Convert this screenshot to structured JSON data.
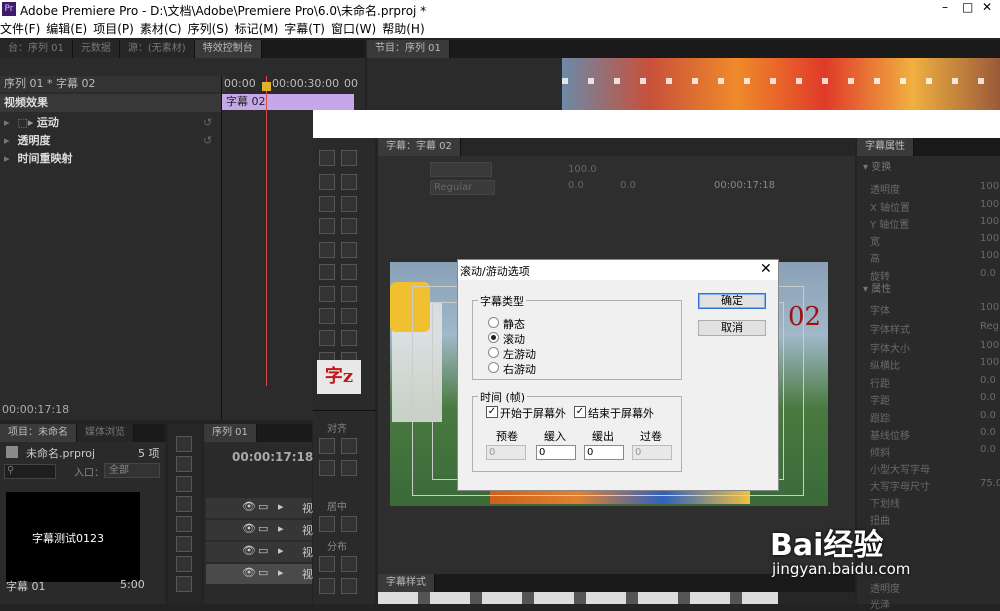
{
  "titlebar": {
    "app_icon": "Pr",
    "title": "Adobe Premiere Pro - D:\\文档\\Adobe\\Premiere Pro\\6.0\\未命名.prproj *"
  },
  "menu": [
    "文件(F)",
    "编辑(E)",
    "项目(P)",
    "素材(C)",
    "序列(S)",
    "标记(M)",
    "字幕(T)",
    "窗口(W)",
    "帮助(H)"
  ],
  "top_left_tabs": [
    "台：序列 01",
    "元数据",
    "源：(无素材)",
    "特效控制台"
  ],
  "top_right_tab": "节目：序列 01",
  "effects": {
    "header": "序列 01 * 字幕 02",
    "timecode_start": "00:00",
    "timecode_mid": "00:00:30:00",
    "timecode_end": "00",
    "clip_label": "字幕 02",
    "section": "视频效果",
    "items": [
      "运动",
      "透明度",
      "时间重映射"
    ],
    "footer_time": "00:00:17:18"
  },
  "project": {
    "tabs": [
      "项目：未命名",
      "媒体浏览"
    ],
    "file": "未命名.prproj",
    "count": "5 项",
    "search_placeholder": "",
    "inlet_label": "入口：",
    "inlet_value": "全部",
    "thumb_text": "字幕测试0123",
    "item_name": "字幕 01",
    "item_duration": "5:00"
  },
  "sequence_panel": {
    "tab": "序列 01",
    "time": "00:00:17:18",
    "track_labels": [
      "视",
      "视",
      "视",
      "视"
    ]
  },
  "title_tools": {
    "char_icon": "字z",
    "align_label": "对齐",
    "center_label": "居中",
    "distribute_label": "分布"
  },
  "title_editor": {
    "tab": "字幕：字幕 02",
    "font_style": "Regular",
    "size": "100.0",
    "kerning": "0.0",
    "leading": "0.0",
    "timecode": "00:00:17:18",
    "preview_text": "02"
  },
  "title_props": {
    "tab": "字幕属性",
    "groups": [
      "变换",
      "属性"
    ],
    "rows": [
      {
        "label": "透明度",
        "value": "100."
      },
      {
        "label": "X 轴位置",
        "value": "100."
      },
      {
        "label": "Y 轴位置",
        "value": "100."
      },
      {
        "label": "宽",
        "value": "100."
      },
      {
        "label": "高",
        "value": "100."
      },
      {
        "label": "旋转",
        "value": "0.0"
      },
      {
        "label": "字体",
        "value": "100."
      },
      {
        "label": "字体样式",
        "value": "Reg"
      },
      {
        "label": "字体大小",
        "value": "100."
      },
      {
        "label": "纵横比",
        "value": "100."
      },
      {
        "label": "行距",
        "value": "0.0"
      },
      {
        "label": "字距",
        "value": "0.0"
      },
      {
        "label": "跟踪",
        "value": "0.0"
      },
      {
        "label": "基线位移",
        "value": "0.0"
      },
      {
        "label": "倾斜",
        "value": "0.0"
      },
      {
        "label": "小型大写字母",
        "value": ""
      },
      {
        "label": "大写字母尺寸",
        "value": "75.0"
      },
      {
        "label": "下划线",
        "value": ""
      },
      {
        "label": "扭曲",
        "value": ""
      },
      {
        "label": "透明度",
        "value": ""
      },
      {
        "label": "光泽",
        "value": ""
      }
    ]
  },
  "title_styles_tab": "字幕样式",
  "dialog": {
    "title": "滚动/游动选项",
    "type_group": "字幕类型",
    "options": [
      "静态",
      "滚动",
      "左游动",
      "右游动"
    ],
    "selected_option": "滚动",
    "timing_group": "时间 (帧)",
    "start_offscreen": "开始于屏幕外",
    "end_offscreen": "结束于屏幕外",
    "fields": [
      {
        "label": "预卷",
        "value": "0",
        "enabled": false
      },
      {
        "label": "缓入",
        "value": "0",
        "enabled": true
      },
      {
        "label": "缓出",
        "value": "0",
        "enabled": true
      },
      {
        "label": "过卷",
        "value": "0",
        "enabled": false
      }
    ],
    "ok": "确定",
    "cancel": "取消"
  },
  "watermark": {
    "brand": "Bai经验",
    "url": "jingyan.baidu.com"
  },
  "colors": {
    "accent_purple": "#c6a8e8",
    "playhead": "#e04848",
    "dialog_bg": "#f0f0f0"
  }
}
